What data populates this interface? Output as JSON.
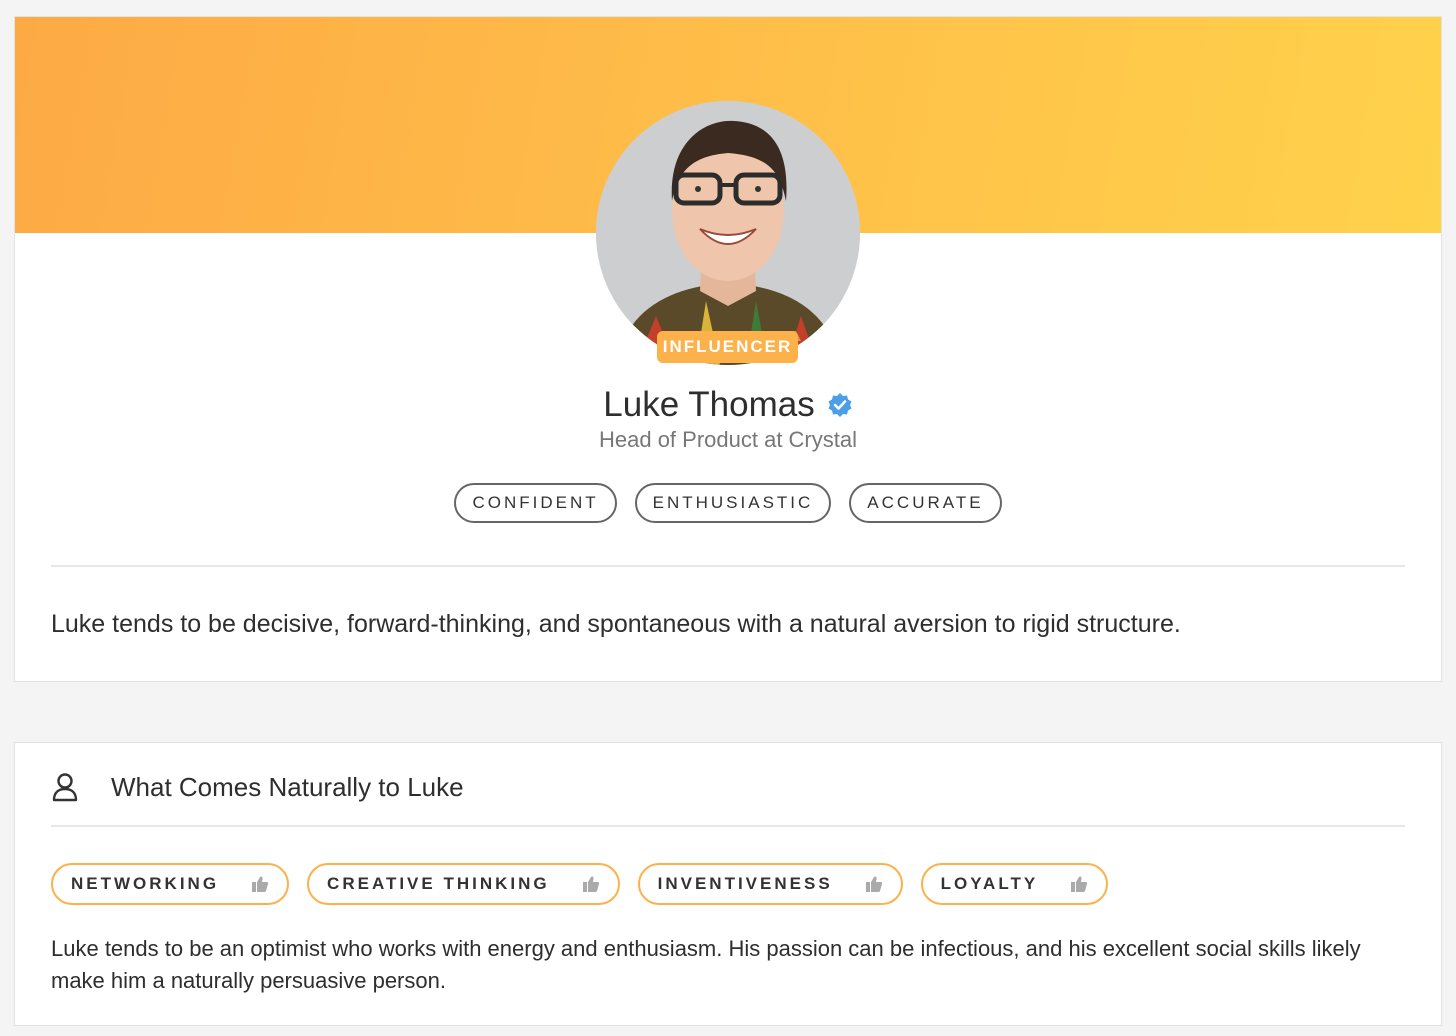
{
  "profile": {
    "badge": "INFLUENCER",
    "name": "Luke Thomas",
    "headline": "Head of Product at Crystal",
    "traits": [
      "CONFIDENT",
      "ENTHUSIASTIC",
      "ACCURATE"
    ],
    "summary": "Luke tends to be decisive, forward-thinking, and spontaneous with a natural aversion to rigid structure."
  },
  "natural_section": {
    "icon": "person-icon",
    "title": "What Comes Naturally to Luke",
    "strengths": [
      "NETWORKING",
      "CREATIVE THINKING",
      "INVENTIVENESS",
      "LOYALTY"
    ],
    "strength_icon": "thumbs-up-icon",
    "description": "Luke tends to be an optimist who works with energy and enthusiasm. His passion can be infectious, and his excellent social skills likely make him a naturally persuasive person."
  },
  "colors": {
    "banner_start": "#fdaa45",
    "banner_end": "#ffd24b",
    "accent": "#fdb14b",
    "verified": "#4a9fe8"
  }
}
